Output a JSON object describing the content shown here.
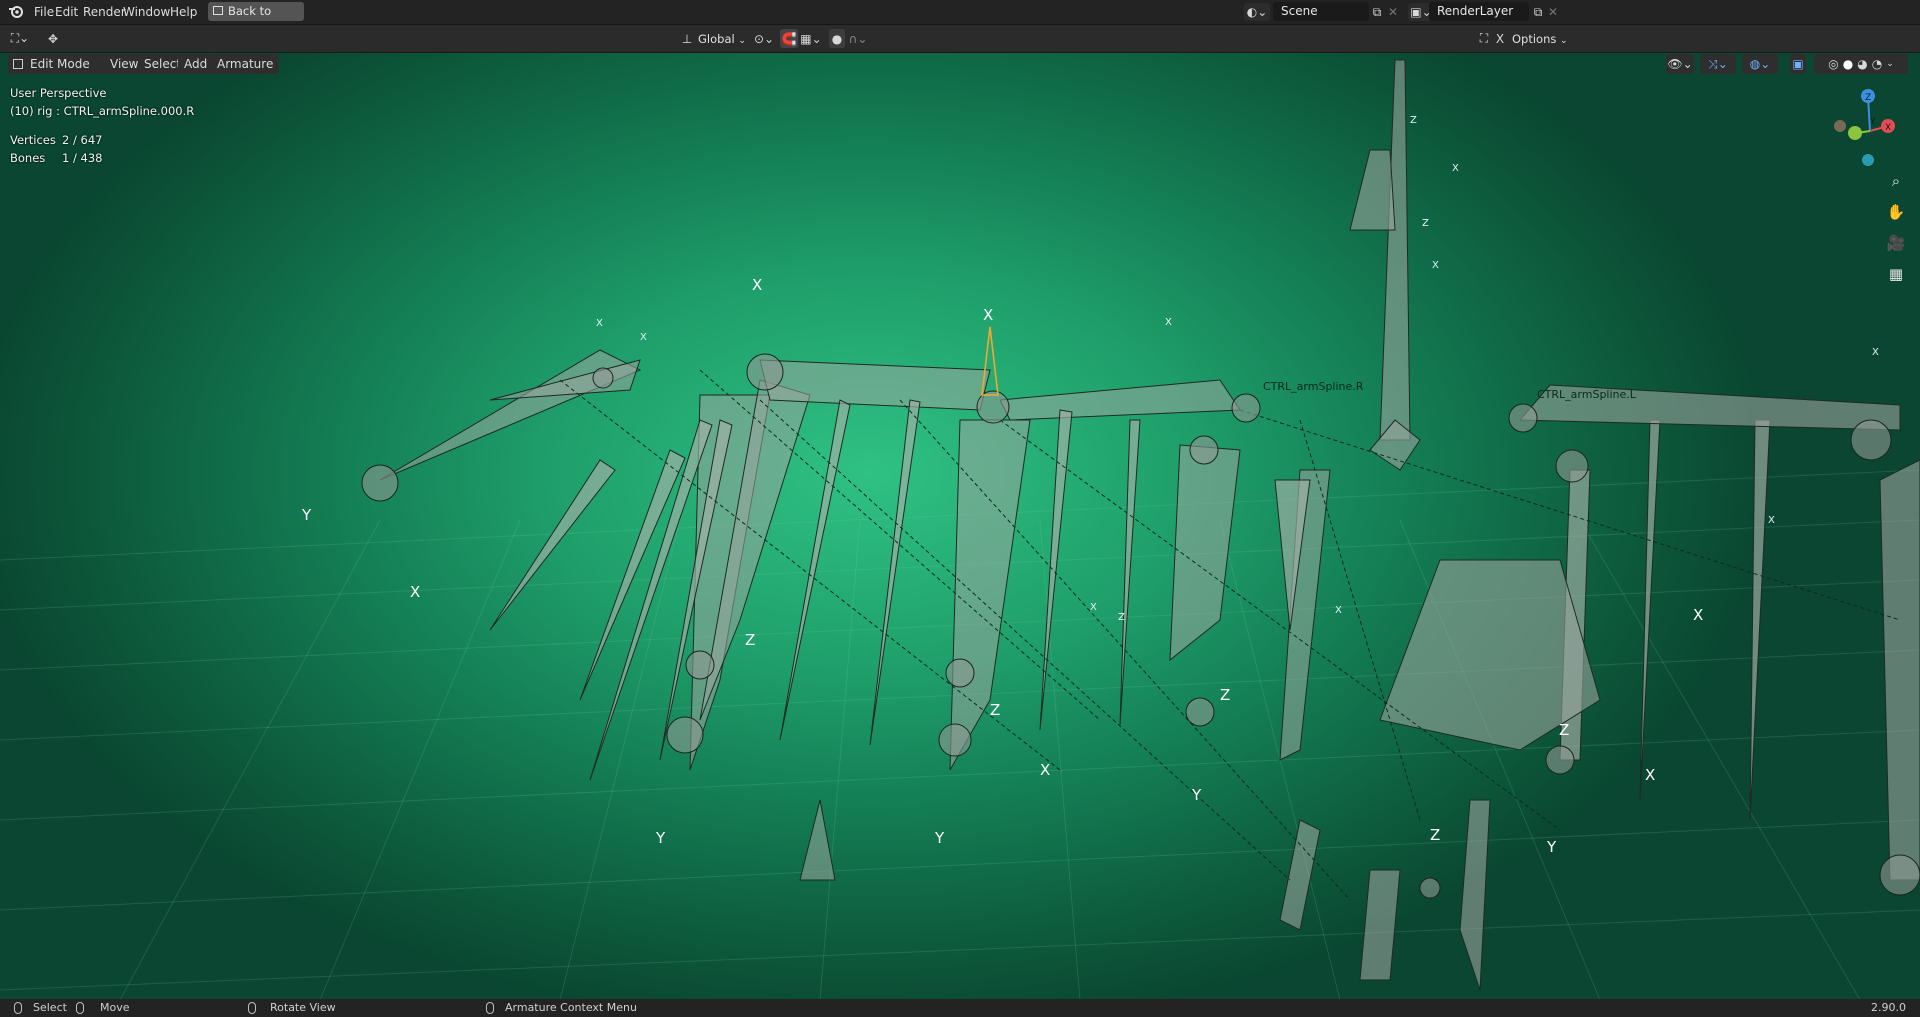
{
  "menu": {
    "items": [
      "File",
      "Edit",
      "Render",
      "Window",
      "Help"
    ],
    "back_button": "Back to Previous"
  },
  "scene": {
    "label": "Scene"
  },
  "render_layer": {
    "label": "RenderLayer"
  },
  "header": {
    "mode": "Edit Mode",
    "menus": [
      "View",
      "Select",
      "Add",
      "Armature"
    ],
    "transform_orientation": "Global",
    "options": "Options"
  },
  "overlay": {
    "perspective": "User Perspective",
    "object": "(10) rig : CTRL_armSpline.000.R",
    "vertices_label": "Vertices",
    "vertices_value": "2 / 647",
    "bones_label": "Bones",
    "bones_value": "1 / 438"
  },
  "bone_labels": [
    "CTRL_armSpline.R",
    "CTRL_armSpline.L"
  ],
  "gizmo": {
    "axes": [
      "Z",
      "Y",
      "X"
    ],
    "colors": {
      "x": "#e44d55",
      "y": "#8bc43f",
      "z": "#3d8fe6"
    }
  },
  "statusbar": {
    "select": "Select",
    "move": "Move",
    "rotate": "Rotate View",
    "context": "Armature Context Menu",
    "version": "2.90.0"
  },
  "colors": {
    "viewport_center": "#2fc184",
    "viewport_edge": "#0a4631",
    "selected_bone": "#f0a830",
    "topbar": "#232323"
  }
}
